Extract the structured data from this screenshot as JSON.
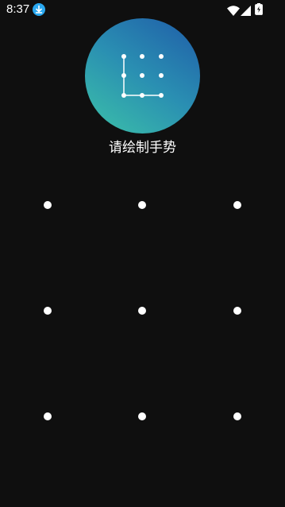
{
  "status_bar": {
    "time": "8:37",
    "notification_icon": "download-icon",
    "right_icons": [
      "wifi-icon",
      "signal-icon",
      "battery-charging-icon"
    ]
  },
  "logo": {
    "icon": "gesture-pattern-icon",
    "gradient_colors": [
      "#3cc2a8",
      "#1f5ca8"
    ]
  },
  "prompt": {
    "text": "请绘制手势"
  },
  "pattern_grid": {
    "rows": 3,
    "cols": 3,
    "dot_color": "#ffffff"
  },
  "colors": {
    "background": "#0f0f0f",
    "badge": "#2aa8f0"
  }
}
